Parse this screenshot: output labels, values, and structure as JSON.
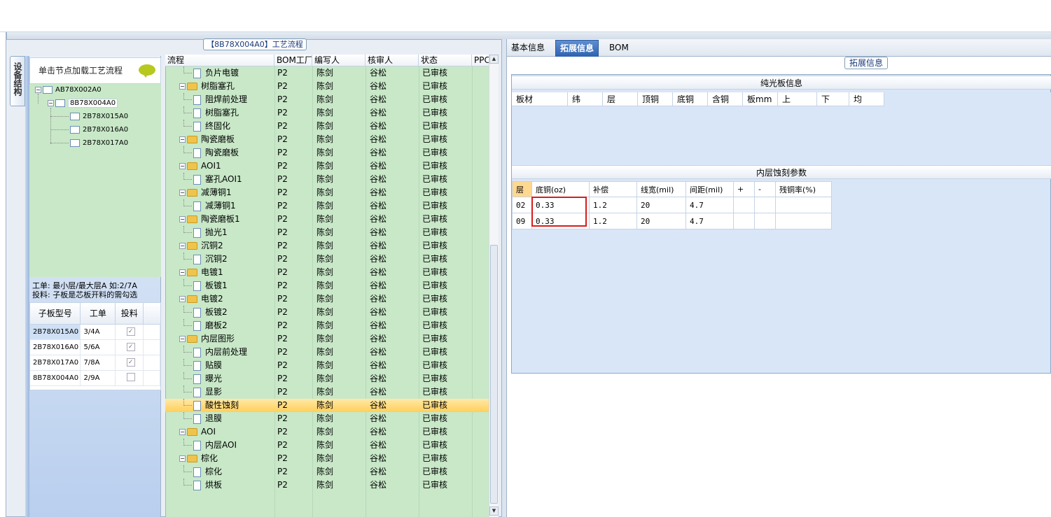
{
  "left_panel": {
    "title": "【8B78X004A0】工艺流程",
    "vertical_tab": "设备结构",
    "hint": "单击节点加载工艺流程",
    "tree": {
      "root": "AB78X002A0",
      "child": "8B78X004A0",
      "leaves": [
        "2B78X015A0",
        "2B78X016A0",
        "2B78X017A0"
      ]
    },
    "info_line1": "工单: 最小层/最大层A 如:2/7A",
    "info_line2": "投料: 子板是芯板开料的需勾选",
    "sub_table": {
      "headers": [
        "子板型号",
        "工单",
        "投料"
      ],
      "rows": [
        {
          "model": "2B78X015A0",
          "order": "3/4A",
          "feed": "✓"
        },
        {
          "model": "2B78X016A0",
          "order": "5/6A",
          "feed": "✓"
        },
        {
          "model": "2B78X017A0",
          "order": "7/8A",
          "feed": "✓"
        },
        {
          "model": "8B78X004A0",
          "order": "2/9A",
          "feed": ""
        }
      ]
    }
  },
  "flow": {
    "headers": [
      "流程",
      "BOM工厂",
      "编写人",
      "核审人",
      "状态",
      "PPC"
    ],
    "rows": [
      {
        "name": "负片电镀",
        "type": "doc",
        "factory": "P2",
        "writer": "陈剑",
        "reviewer": "谷松",
        "status": "已审核"
      },
      {
        "name": "树脂塞孔",
        "type": "folder",
        "factory": "P2",
        "writer": "陈剑",
        "reviewer": "谷松",
        "status": "已审核"
      },
      {
        "name": "阻焊前处理",
        "type": "doc",
        "factory": "P2",
        "writer": "陈剑",
        "reviewer": "谷松",
        "status": "已审核"
      },
      {
        "name": "树脂塞孔",
        "type": "doc",
        "factory": "P2",
        "writer": "陈剑",
        "reviewer": "谷松",
        "status": "已审核"
      },
      {
        "name": "终固化",
        "type": "doc",
        "factory": "P2",
        "writer": "陈剑",
        "reviewer": "谷松",
        "status": "已审核"
      },
      {
        "name": "陶瓷磨板",
        "type": "folder",
        "factory": "P2",
        "writer": "陈剑",
        "reviewer": "谷松",
        "status": "已审核"
      },
      {
        "name": "陶瓷磨板",
        "type": "doc",
        "factory": "P2",
        "writer": "陈剑",
        "reviewer": "谷松",
        "status": "已审核"
      },
      {
        "name": "AOI1",
        "type": "folder",
        "factory": "P2",
        "writer": "陈剑",
        "reviewer": "谷松",
        "status": "已审核"
      },
      {
        "name": "塞孔AOI1",
        "type": "doc",
        "factory": "P2",
        "writer": "陈剑",
        "reviewer": "谷松",
        "status": "已审核"
      },
      {
        "name": "减薄铜1",
        "type": "folder",
        "factory": "P2",
        "writer": "陈剑",
        "reviewer": "谷松",
        "status": "已审核"
      },
      {
        "name": "减薄铜1",
        "type": "doc",
        "factory": "P2",
        "writer": "陈剑",
        "reviewer": "谷松",
        "status": "已审核"
      },
      {
        "name": "陶瓷磨板1",
        "type": "folder",
        "factory": "P2",
        "writer": "陈剑",
        "reviewer": "谷松",
        "status": "已审核"
      },
      {
        "name": "抛光1",
        "type": "doc",
        "factory": "P2",
        "writer": "陈剑",
        "reviewer": "谷松",
        "status": "已审核"
      },
      {
        "name": "沉铜2",
        "type": "folder",
        "factory": "P2",
        "writer": "陈剑",
        "reviewer": "谷松",
        "status": "已审核"
      },
      {
        "name": "沉铜2",
        "type": "doc",
        "factory": "P2",
        "writer": "陈剑",
        "reviewer": "谷松",
        "status": "已审核"
      },
      {
        "name": "电镀1",
        "type": "folder",
        "factory": "P2",
        "writer": "陈剑",
        "reviewer": "谷松",
        "status": "已审核"
      },
      {
        "name": "板镀1",
        "type": "doc",
        "factory": "P2",
        "writer": "陈剑",
        "reviewer": "谷松",
        "status": "已审核"
      },
      {
        "name": "电镀2",
        "type": "folder",
        "factory": "P2",
        "writer": "陈剑",
        "reviewer": "谷松",
        "status": "已审核"
      },
      {
        "name": "板镀2",
        "type": "doc",
        "factory": "P2",
        "writer": "陈剑",
        "reviewer": "谷松",
        "status": "已审核"
      },
      {
        "name": "磨板2",
        "type": "doc",
        "factory": "P2",
        "writer": "陈剑",
        "reviewer": "谷松",
        "status": "已审核"
      },
      {
        "name": "内层图形",
        "type": "folder",
        "factory": "P2",
        "writer": "陈剑",
        "reviewer": "谷松",
        "status": "已审核"
      },
      {
        "name": "内层前处理",
        "type": "doc",
        "factory": "P2",
        "writer": "陈剑",
        "reviewer": "谷松",
        "status": "已审核"
      },
      {
        "name": "贴膜",
        "type": "doc",
        "factory": "P2",
        "writer": "陈剑",
        "reviewer": "谷松",
        "status": "已审核"
      },
      {
        "name": "曝光",
        "type": "doc",
        "factory": "P2",
        "writer": "陈剑",
        "reviewer": "谷松",
        "status": "已审核"
      },
      {
        "name": "显影",
        "type": "doc",
        "factory": "P2",
        "writer": "陈剑",
        "reviewer": "谷松",
        "status": "已审核"
      },
      {
        "name": "酸性蚀刻",
        "type": "doc",
        "factory": "P2",
        "writer": "陈剑",
        "reviewer": "谷松",
        "status": "已审核",
        "selected": true
      },
      {
        "name": "退膜",
        "type": "doc",
        "factory": "P2",
        "writer": "陈剑",
        "reviewer": "谷松",
        "status": "已审核"
      },
      {
        "name": "AOI",
        "type": "folder",
        "factory": "P2",
        "writer": "陈剑",
        "reviewer": "谷松",
        "status": "已审核"
      },
      {
        "name": "内层AOI",
        "type": "doc",
        "factory": "P2",
        "writer": "陈剑",
        "reviewer": "谷松",
        "status": "已审核"
      },
      {
        "name": "棕化",
        "type": "folder",
        "factory": "P2",
        "writer": "陈剑",
        "reviewer": "谷松",
        "status": "已审核"
      },
      {
        "name": "棕化",
        "type": "doc",
        "factory": "P2",
        "writer": "陈剑",
        "reviewer": "谷松",
        "status": "已审核"
      },
      {
        "name": "烘板",
        "type": "doc",
        "factory": "P2",
        "writer": "陈剑",
        "reviewer": "谷松",
        "status": "已审核"
      }
    ]
  },
  "tabs": [
    "基本信息",
    "拓展信息",
    "BOM"
  ],
  "active_tab": "拓展信息",
  "ext": {
    "title": "拓展信息",
    "pure_title": "纯光板信息",
    "pure_columns": [
      "板材",
      "纬",
      "层",
      "顶铜",
      "底铜",
      "含铜",
      "板mm",
      "上",
      "下",
      "均"
    ],
    "etch_title": "内层蚀刻参数",
    "etch_columns": [
      "层",
      "底铜(oz)",
      "补偿",
      "线宽(mil)",
      "间距(mil)",
      "+",
      "-",
      "残铜率(%)"
    ],
    "etch_rows": [
      {
        "layer": "02",
        "base": "0.33",
        "comp": "1.2",
        "width": "20",
        "gap": "4.7",
        "plus": "",
        "minus": "",
        "rate": ""
      },
      {
        "layer": "09",
        "base": "0.33",
        "comp": "1.2",
        "width": "20",
        "gap": "4.7",
        "plus": "",
        "minus": "",
        "rate": ""
      }
    ]
  },
  "colors": {
    "tree_bg": "#c8e8c8",
    "tab_active": "#2d62b0",
    "highlight_row": "#ffcf5a",
    "annotation_box": "#d91c1c"
  }
}
